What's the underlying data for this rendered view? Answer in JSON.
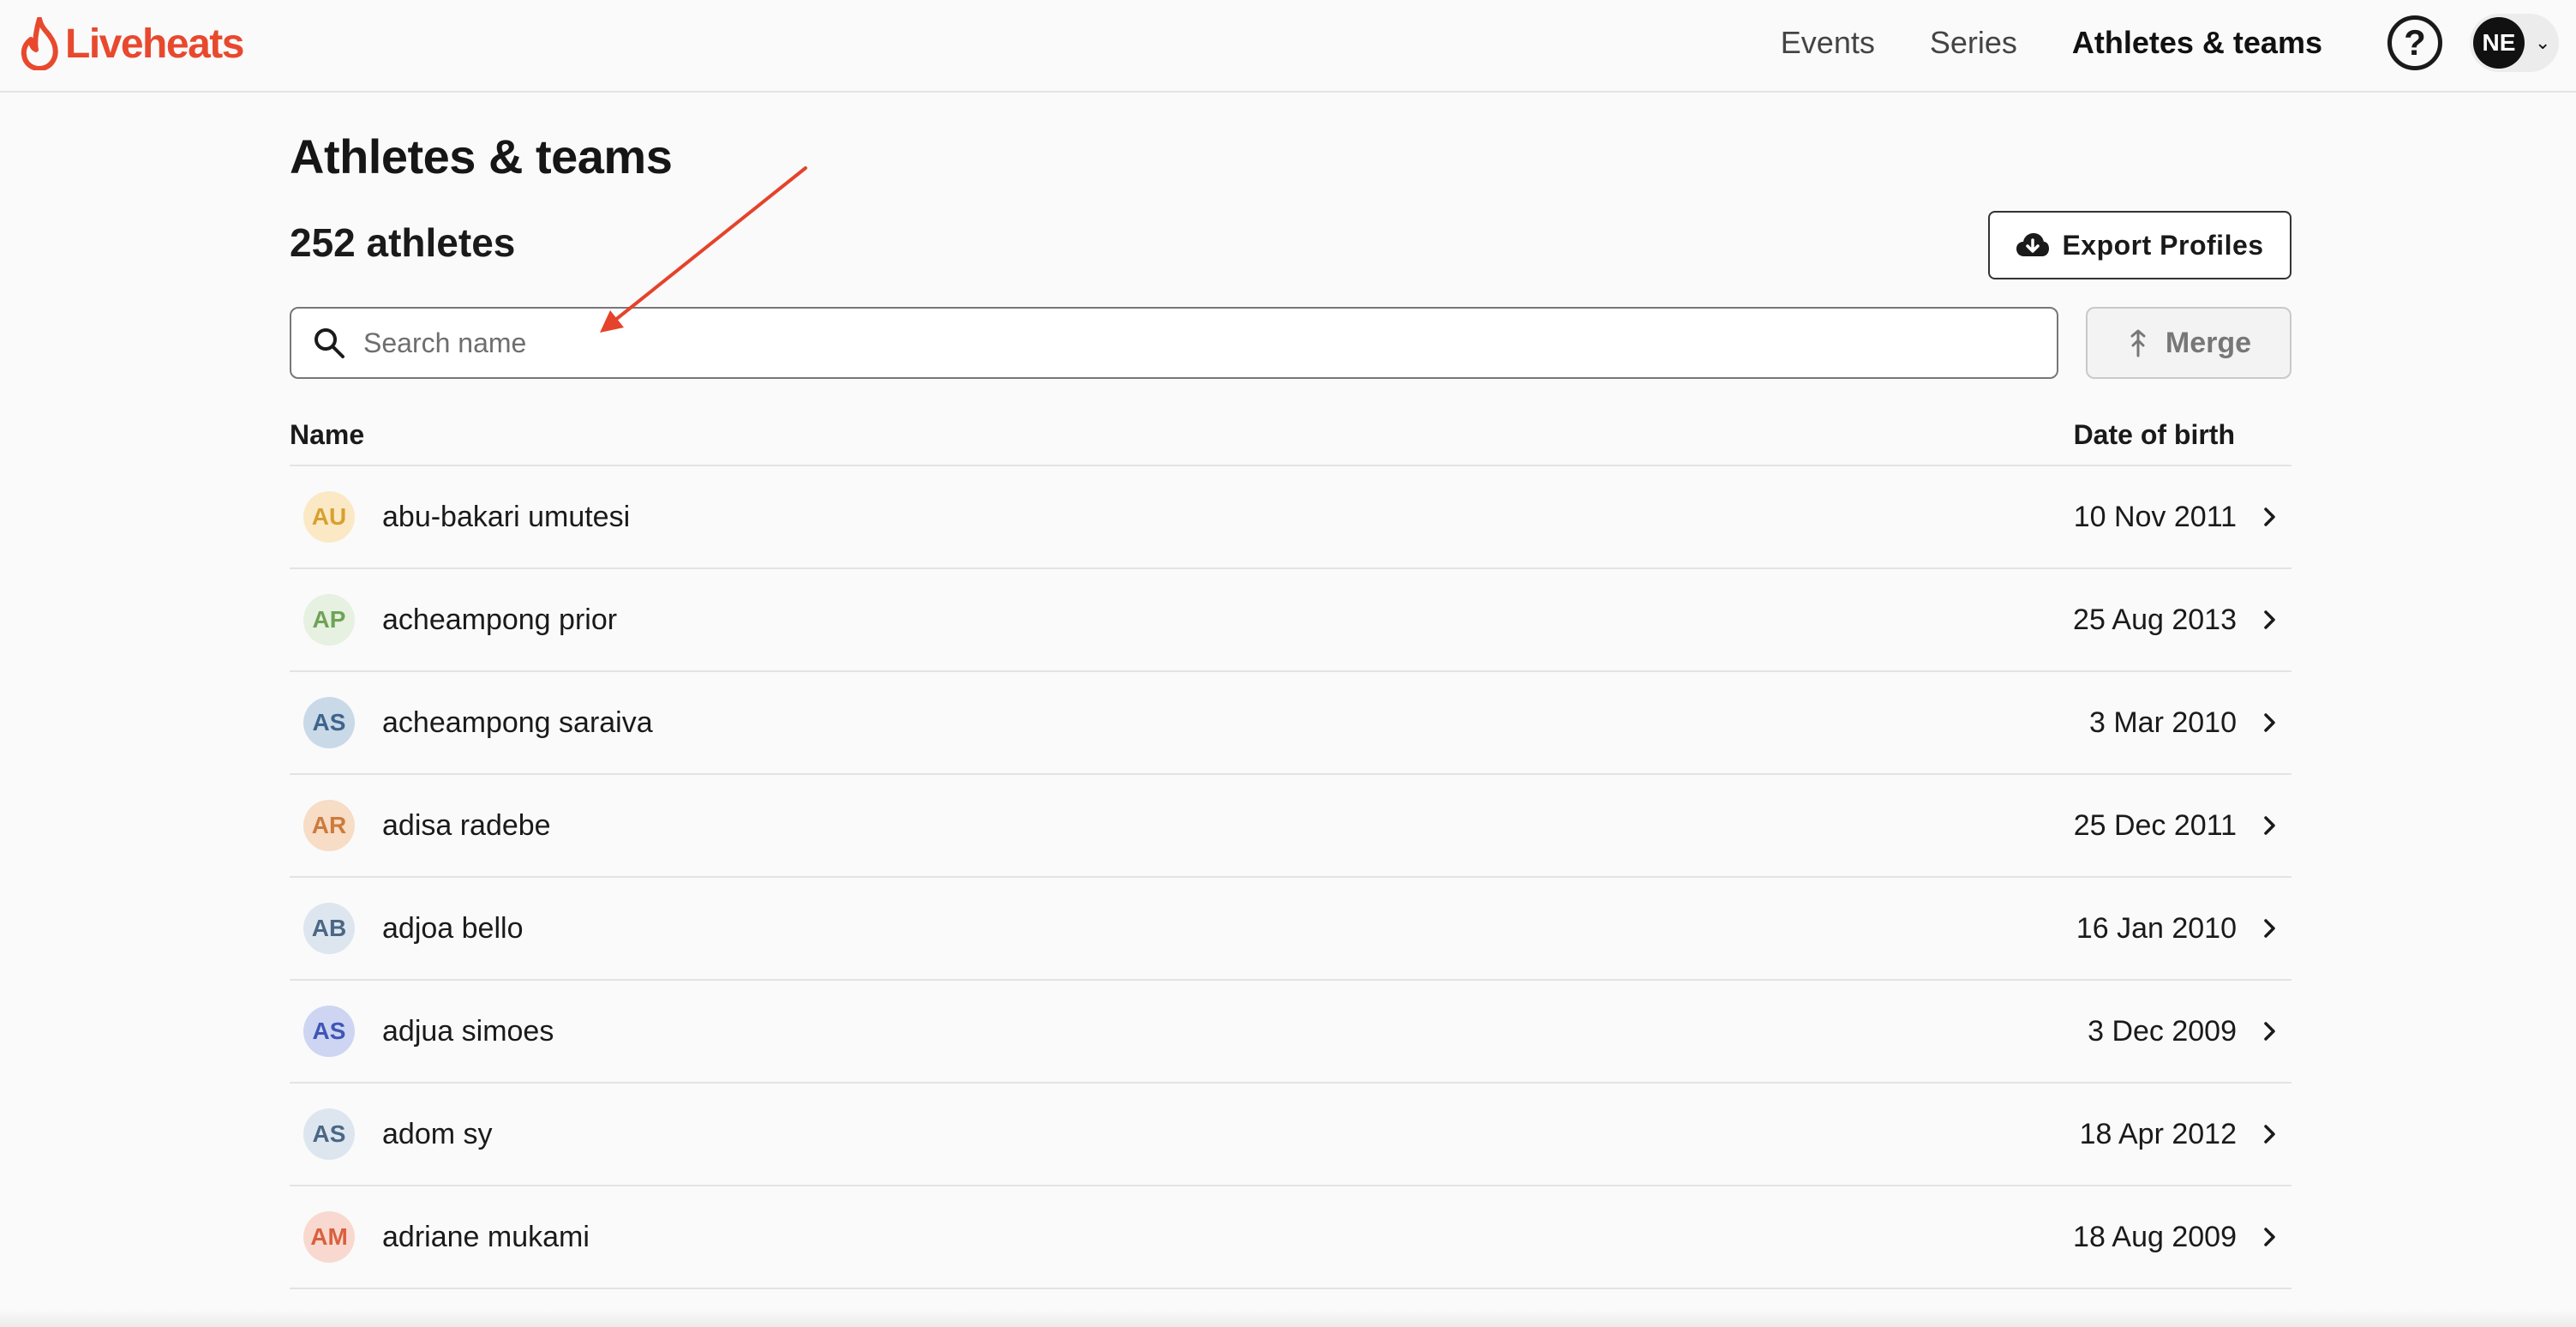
{
  "header": {
    "logo_text": "Liveheats",
    "nav": [
      {
        "label": "Events",
        "active": false
      },
      {
        "label": "Series",
        "active": false
      },
      {
        "label": "Athletes & teams",
        "active": true
      }
    ],
    "help_symbol": "?",
    "avatar_initials": "NE",
    "avatar_chevron": "⌄"
  },
  "page": {
    "title": "Athletes & teams",
    "count": "252 athletes",
    "export_label": "Export Profiles",
    "merge_label": "Merge",
    "search_placeholder": "Search name",
    "search_value": "",
    "col_name": "Name",
    "col_dob": "Date of birth"
  },
  "athletes": [
    {
      "initials": "AU",
      "name": "abu-bakari umutesi",
      "dob": "10 Nov 2011",
      "bg": "#fbe9c5",
      "fg": "#d9a02e"
    },
    {
      "initials": "AP",
      "name": "acheampong prior",
      "dob": "25 Aug 2013",
      "bg": "#e6f1e1",
      "fg": "#6fa356"
    },
    {
      "initials": "AS",
      "name": "acheampong saraiva",
      "dob": "3 Mar 2010",
      "bg": "#c9d9e8",
      "fg": "#3e648c"
    },
    {
      "initials": "AR",
      "name": "adisa radebe",
      "dob": "25 Dec 2011",
      "bg": "#f7dcc6",
      "fg": "#cc7b3d"
    },
    {
      "initials": "AB",
      "name": "adjoa bello",
      "dob": "16 Jan 2010",
      "bg": "#dde6ef",
      "fg": "#4a6785"
    },
    {
      "initials": "AS",
      "name": "adjua simoes",
      "dob": "3 Dec 2009",
      "bg": "#cdd5f3",
      "fg": "#3f56b5"
    },
    {
      "initials": "AS",
      "name": "adom sy",
      "dob": "18 Apr 2012",
      "bg": "#dde6ef",
      "fg": "#4a6785"
    },
    {
      "initials": "AM",
      "name": "adriane mukami",
      "dob": "18 Aug 2009",
      "bg": "#f9d9cf",
      "fg": "#d9603e"
    }
  ],
  "colors": {
    "brand": "#e8492e",
    "annotation_arrow": "#e5432b"
  },
  "icons": [
    "flame-logo-icon",
    "help-icon",
    "chevron-down-icon",
    "cloud-download-icon",
    "search-icon",
    "merge-icon",
    "chevron-right-icon"
  ]
}
